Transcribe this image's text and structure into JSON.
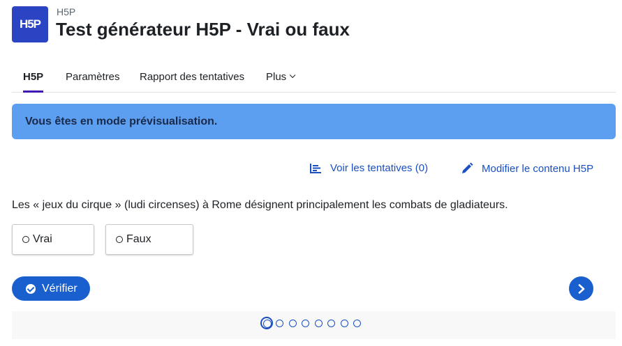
{
  "header": {
    "logo_text": "H5P",
    "activity_type": "H5P",
    "title": "Test générateur H5P - Vrai ou faux"
  },
  "tabs": [
    {
      "label": "H5P",
      "active": true
    },
    {
      "label": "Paramètres",
      "active": false
    },
    {
      "label": "Rapport des tentatives",
      "active": false
    },
    {
      "label": "Plus",
      "active": false
    }
  ],
  "alert": {
    "text": "Vous êtes en mode prévisualisation."
  },
  "actions": {
    "view_attempts": "Voir les tentatives (0)",
    "edit_content": "Modifier le contenu H5P"
  },
  "question": {
    "text": "Les « jeux du cirque » (ludi circenses) à Rome désignent principalement les combats de gladiateurs.",
    "options": [
      "Vrai",
      "Faux"
    ]
  },
  "controls": {
    "check_label": "Vérifier",
    "next_icon": "chevron-right-icon"
  },
  "progress": {
    "total_pages": 8,
    "current_page": 1
  },
  "colors": {
    "brand": "#2a44c4",
    "accent": "#1a5fce",
    "alert_bg": "#5c9ef0",
    "tab_indicator": "#3f18b6"
  }
}
